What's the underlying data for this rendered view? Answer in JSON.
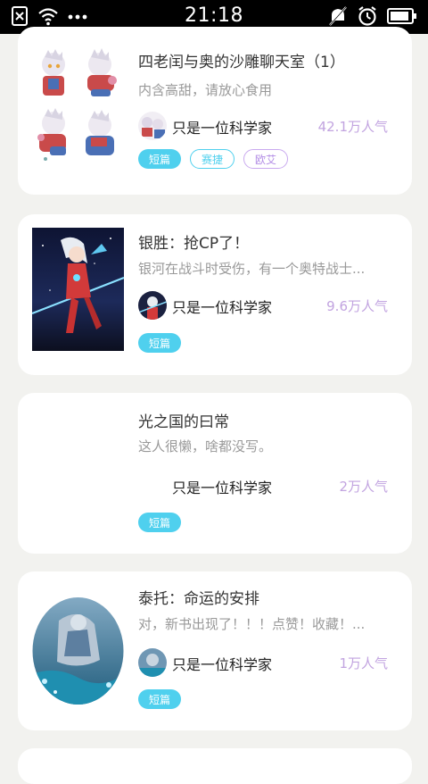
{
  "status_bar": {
    "time": "21:18",
    "icons_left": [
      "sim-off-icon",
      "wifi-icon",
      "more-dots-icon"
    ],
    "icons_right": [
      "mute-icon",
      "alarm-icon",
      "battery-icon"
    ]
  },
  "cards": [
    {
      "title": "四老闰与奥的沙雕聊天室（1）",
      "desc": "内含高甜，请放心食用",
      "author": "只是一位科学家",
      "popularity": "42.1万人气",
      "tags": [
        "短篇",
        "赛捷",
        "欧艾"
      ]
    },
    {
      "title": "银胜：抢CP了！",
      "desc": "银河在战斗时受伤，有一个奥特战士...",
      "author": "只是一位科学家",
      "popularity": "9.6万人气",
      "tags": [
        "短篇"
      ]
    },
    {
      "title": "光之国的曰常",
      "desc": "这人很懒，啥都没写。",
      "author": "只是一位科学家",
      "popularity": "2万人气",
      "tags": [
        "短篇"
      ]
    },
    {
      "title": "泰托：命运的安排",
      "desc": "对，新书出现了！！！点赞！收藏！...",
      "author": "只是一位科学家",
      "popularity": "1万人气",
      "tags": [
        "短篇"
      ]
    }
  ],
  "colors": {
    "accent": "#4fd0ee",
    "popularity": "#c2a4e0",
    "background": "#f2f2ef"
  }
}
